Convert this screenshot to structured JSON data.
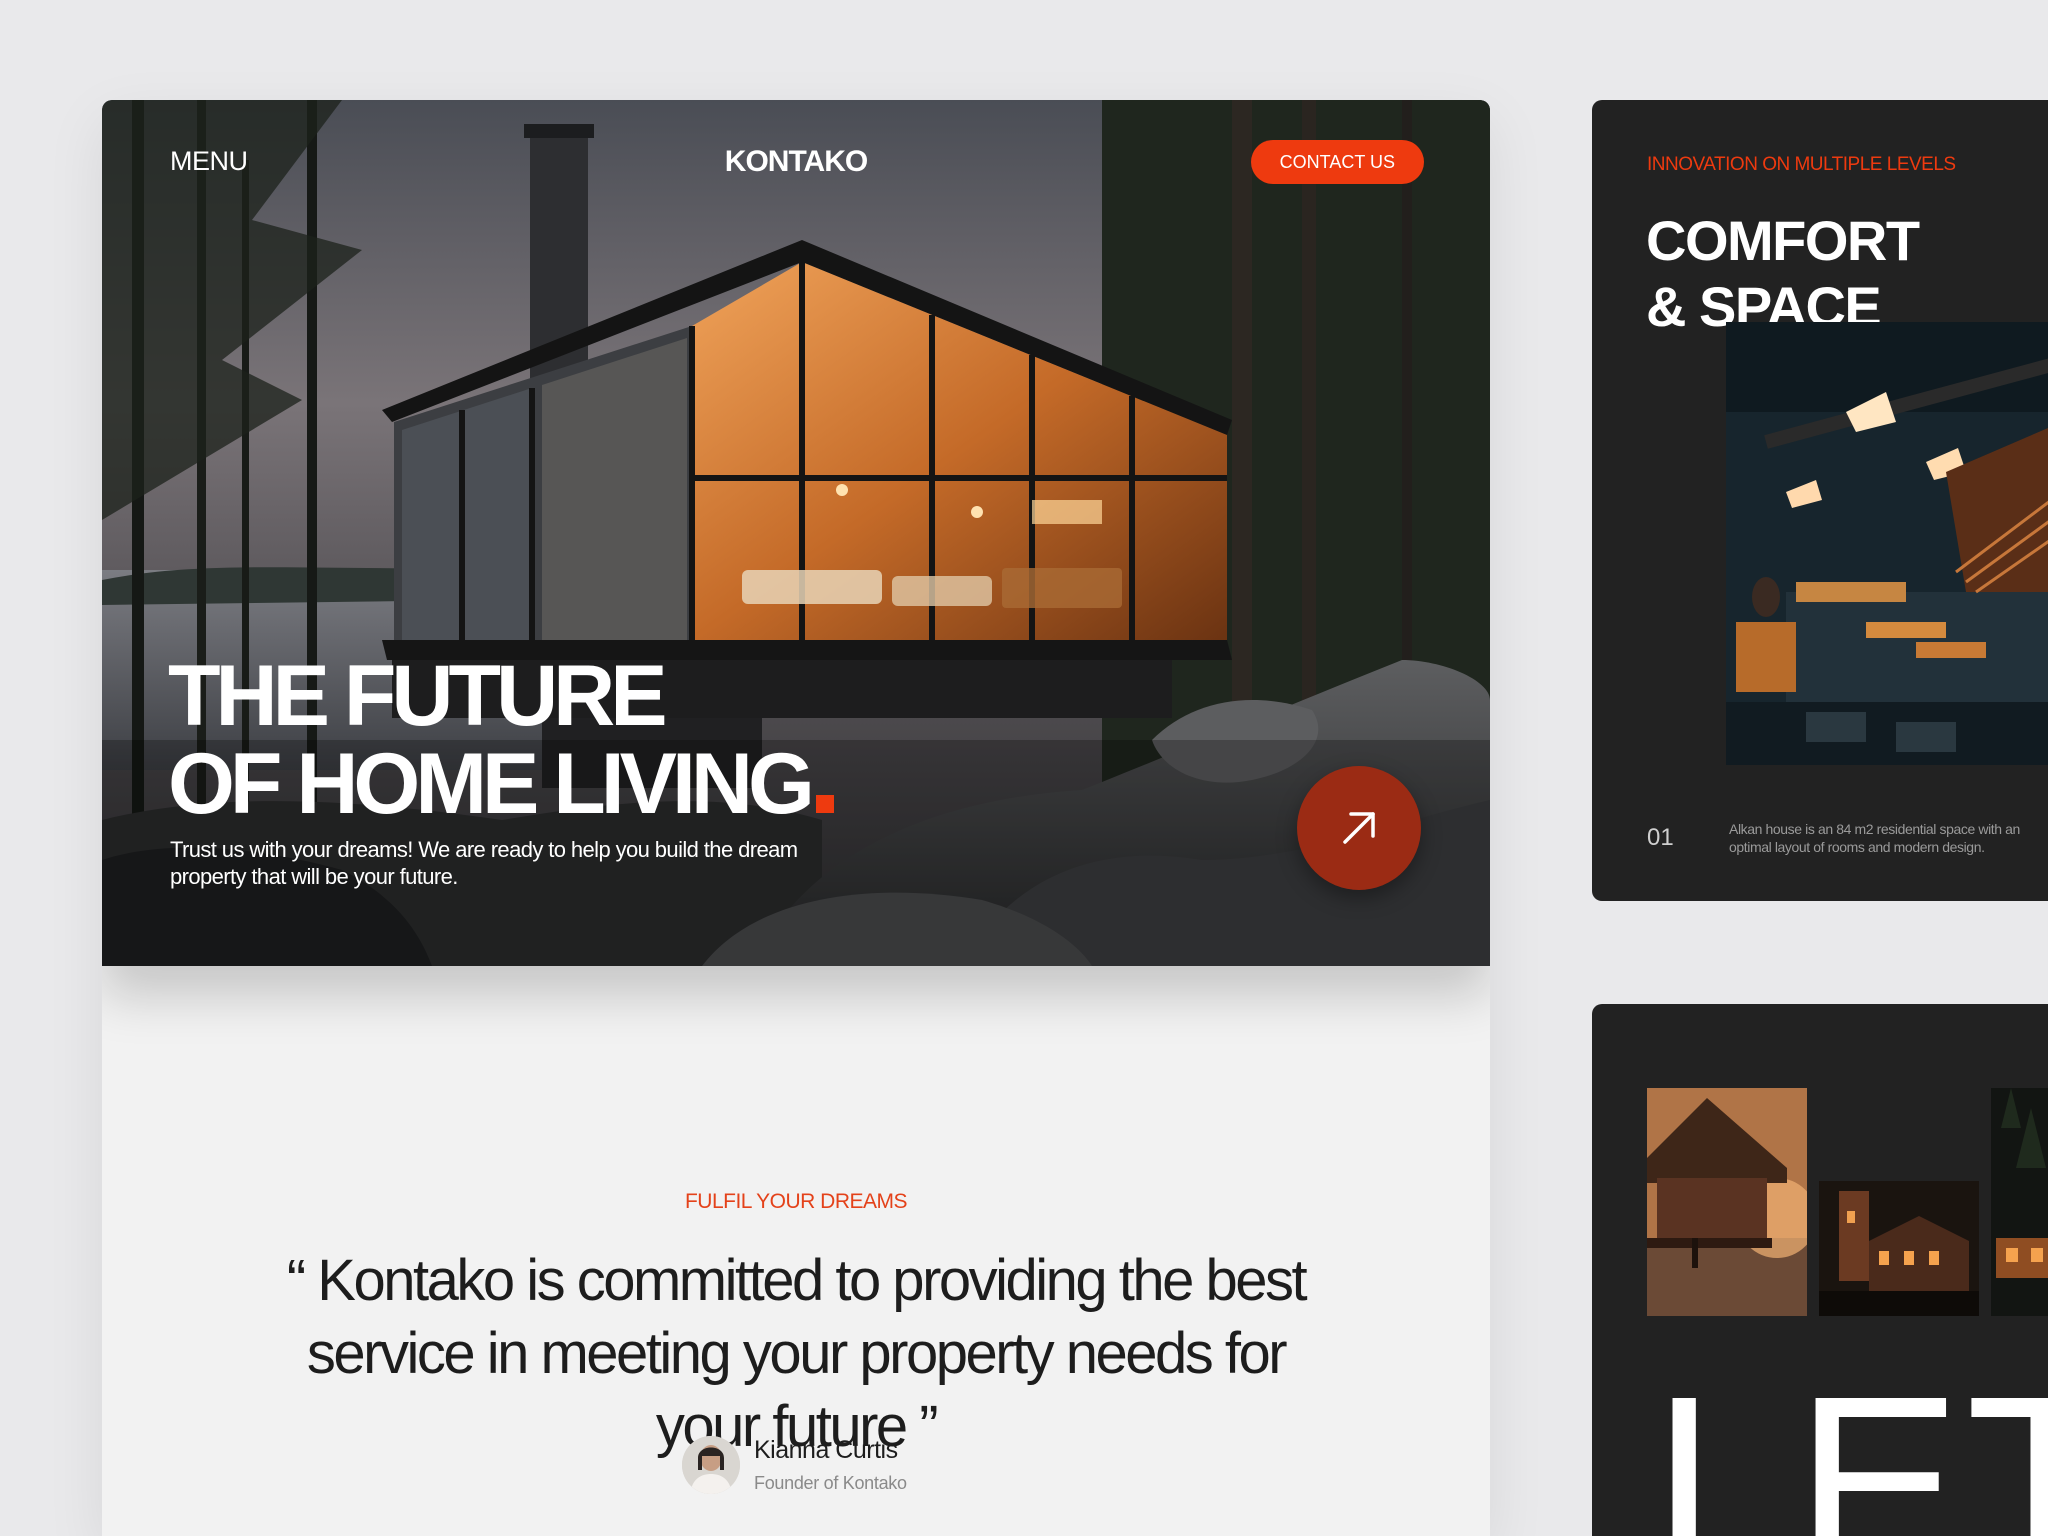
{
  "hero": {
    "menu_label": "MENU",
    "logo": "KONTAKO",
    "contact_label": "CONTACT US",
    "title_line1": "THE FUTURE",
    "title_line2": "OF HOME LIVING",
    "subtitle": "Trust us with your dreams! We are ready to help you build the dream property that will be your future."
  },
  "quote_section": {
    "eyebrow": "FULFIL YOUR DREAMS",
    "quote": "“ Kontako is committed to providing the best service in meeting your property needs for your future ”",
    "author_name": "Kianna Curtis",
    "author_role": "Founder of Kontako"
  },
  "feature_card": {
    "eyebrow": "INNOVATION ON MULTIPLE LEVELS",
    "title_line1": "COMFORT",
    "title_line2": "& SPACE",
    "counter": "01",
    "description": "Alkan house is an 84 m2 residential space with an optimal layout of rooms and modern design."
  },
  "gallery_card": {
    "big_text": "LET’S"
  },
  "colors": {
    "accent": "#ee3a0f",
    "dark_card": "#222222",
    "page_bg": "#e9e9eb",
    "light_card": "#f2f2f2"
  },
  "icons": {
    "hero_button": "arrow-up-right-icon"
  }
}
